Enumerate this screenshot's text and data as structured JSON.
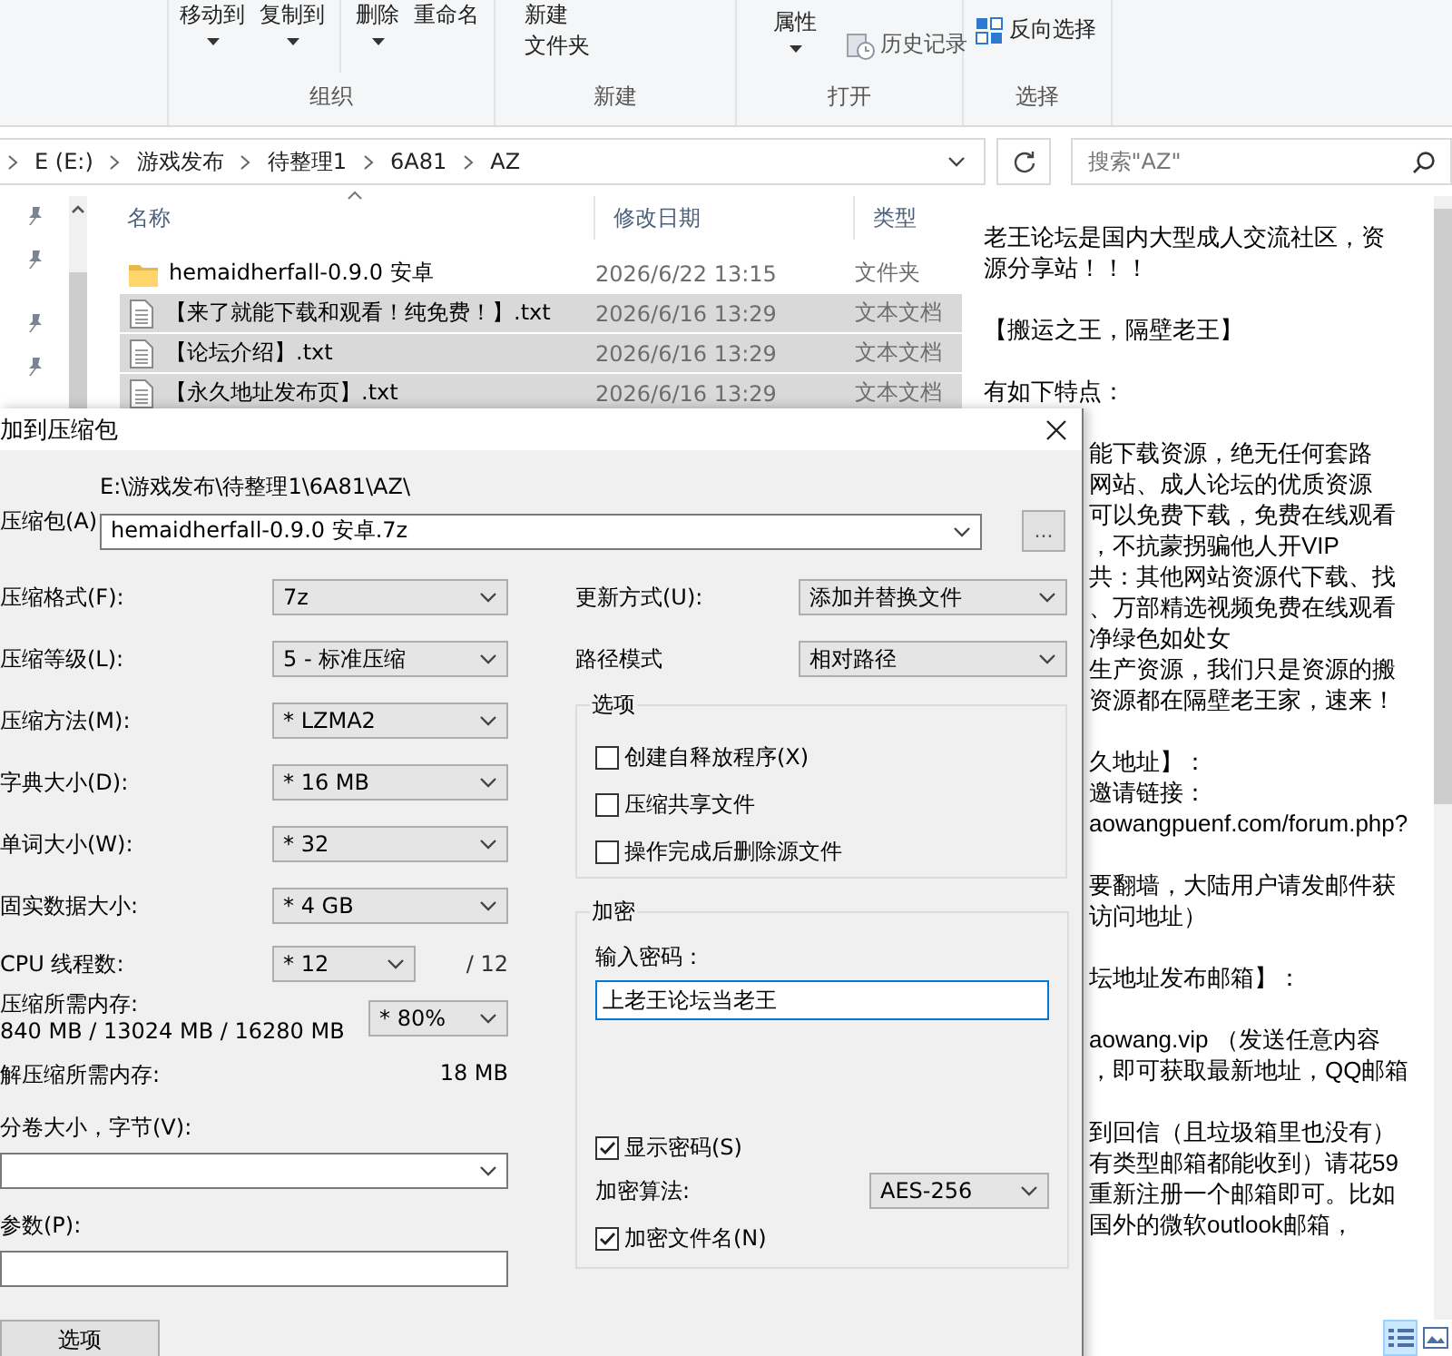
{
  "ribbon": {
    "groups": [
      {
        "label": "组织",
        "items": [
          {
            "kind": "menu",
            "label": "移动到"
          },
          {
            "kind": "menu",
            "label": "复制到"
          },
          {
            "kind": "divider"
          },
          {
            "kind": "menu",
            "label": "删除"
          },
          {
            "kind": "plain",
            "label": "重命名"
          }
        ]
      },
      {
        "label": "新建",
        "items": [
          {
            "kind": "stack",
            "lines": [
              "新建",
              "文件夹"
            ]
          }
        ]
      },
      {
        "label": "打开",
        "items": [
          {
            "kind": "menu",
            "label": "属性"
          },
          {
            "kind": "small",
            "label": "历史记录"
          }
        ]
      },
      {
        "label": "选择",
        "items": [
          {
            "kind": "small",
            "label": "反向选择"
          }
        ]
      }
    ]
  },
  "address": {
    "path": [
      "E (E:)",
      "游戏发布",
      "待整理1",
      "6A81",
      "AZ"
    ],
    "search_placeholder": "搜索\"AZ\""
  },
  "files": {
    "columns": [
      "名称",
      "修改日期",
      "类型"
    ],
    "rows": [
      {
        "kind": "folder",
        "name": "hemaidherfall-0.9.0 安卓",
        "date": "2026/6/22 13:15",
        "type": "文件夹",
        "selected": false
      },
      {
        "kind": "text",
        "name": "【来了就能下载和观看！纯免费！】.txt",
        "date": "2026/6/16 13:29",
        "type": "文本文档",
        "selected": true
      },
      {
        "kind": "text",
        "name": "【论坛介绍】.txt",
        "date": "2026/6/16 13:29",
        "type": "文本文档",
        "selected": true
      },
      {
        "kind": "text",
        "name": "【永久地址发布页】.txt",
        "date": "2026/6/16 13:29",
        "type": "文本文档",
        "selected": true
      }
    ]
  },
  "preview": {
    "paragraphs": [
      [
        "老王论坛是国内大型成人交流社区，资",
        "源分享站！！！"
      ],
      [
        "【搬运之王，隔壁老王】"
      ],
      [
        "有如下特点："
      ]
    ],
    "beside_dialog": [
      [
        "能下载资源，绝无任何套路",
        "网站、成人论坛的优质资源",
        "可以免费下载，免费在线观看",
        "，不抗蒙拐骗他人开VIP",
        "共：其他网站资源代下载、找",
        "、万部精选视频免费在线观看",
        "净绿色如处女",
        "生产资源，我们只是资源的搬",
        "资源都在隔壁老王家，速来！"
      ],
      [
        "久地址】：",
        "邀请链接：",
        "aowangpuenf.com/forum.php?"
      ],
      [
        "要翻墙，大陆用户请发邮件获",
        "访问地址）"
      ],
      [
        "坛地址发布邮箱】："
      ],
      [
        "aowang.vip  （发送任意内容",
        "，即可获取最新地址，QQ邮箱"
      ],
      [
        "到回信（且垃圾箱里也没有）",
        "有类型邮箱都能收到）请花59",
        "重新注册一个邮箱即可。比如",
        "国外的微软outlook邮箱，"
      ]
    ]
  },
  "dialog": {
    "title": "加到压缩包",
    "archive": {
      "label": "压缩包(A)",
      "path": "E:\\游戏发布\\待整理1\\6A81\\AZ\\",
      "value": "hemaidherfall-0.9.0 安卓.7z",
      "browse": "..."
    },
    "left_settings": [
      {
        "label": "压缩格式(F):",
        "value": "7z"
      },
      {
        "label": "压缩等级(L):",
        "value": "5 - 标准压缩"
      },
      {
        "label": "压缩方法(M):",
        "value": "* LZMA2"
      },
      {
        "label": "字典大小(D):",
        "value": "* 16 MB"
      },
      {
        "label": "单词大小(W):",
        "value": "* 32"
      },
      {
        "label": "固实数据大小:",
        "value": "* 4 GB"
      }
    ],
    "threads": {
      "label": "CPU 线程数:",
      "value": "* 12",
      "max": "/ 12"
    },
    "memory": {
      "label": "压缩所需内存:",
      "reading": "840 MB / 13024 MB / 16280 MB",
      "value": "* 80%"
    },
    "decompress_memory": {
      "label": "解压缩所需内存:",
      "reading": "18 MB"
    },
    "volume": {
      "label": "分卷大小，字节(V):"
    },
    "params": {
      "label": "参数(P):"
    },
    "options_button": "选项",
    "right_settings": [
      {
        "label": "更新方式(U):",
        "value": "添加并替换文件"
      },
      {
        "label": "路径模式",
        "value": "相对路径"
      }
    ],
    "options_group": {
      "title": "选项",
      "checkboxes": [
        {
          "label": "创建自释放程序(X)",
          "checked": false
        },
        {
          "label": "压缩共享文件",
          "checked": false
        },
        {
          "label": "操作完成后删除源文件",
          "checked": false
        }
      ]
    },
    "encryption": {
      "title": "加密",
      "password_label": "输入密码：",
      "password": "上老王论坛当老王",
      "show_password": {
        "label": "显示密码(S)",
        "checked": true
      },
      "method_label": "加密算法:",
      "method": "AES-256",
      "encrypt_names": {
        "label": "加密文件名(N)",
        "checked": true
      }
    }
  }
}
